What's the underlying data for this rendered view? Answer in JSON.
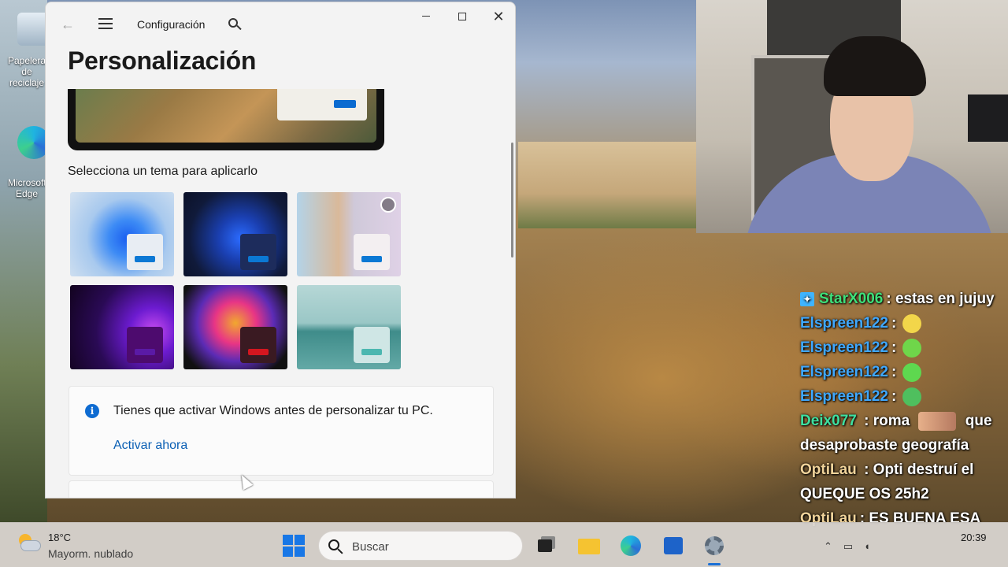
{
  "desktop": {
    "icons": [
      {
        "label": "Papelera de reciclaje"
      },
      {
        "label": "Microsoft Edge"
      }
    ]
  },
  "settings_window": {
    "app_title": "Configuración",
    "page_title": "Personalización",
    "theme_section_label": "Selecciona un tema para aplicarlo",
    "themes": [
      {
        "accent": "#0b78d4",
        "card": "#e8edf3"
      },
      {
        "accent": "#0b78d4",
        "card": "#1d2c5c"
      },
      {
        "accent": "#0b78d4",
        "card": "#f3eff1"
      },
      {
        "accent": "#5a1aa6",
        "card": "#4d0b6e"
      },
      {
        "accent": "#d4161f",
        "card": "#3a1a22"
      },
      {
        "accent": "#4cb7b0",
        "card": "#cfe6e5"
      }
    ],
    "activation": {
      "message": "Tienes que activar Windows antes de personalizar tu PC.",
      "link": "Activar ahora"
    }
  },
  "chat": {
    "messages": [
      {
        "user": "StarX006",
        "user_color": "#3ee07a",
        "text": ": estas en jujuy",
        "badge": true
      },
      {
        "user": "Elspreen122",
        "user_color": "#3fa8ff",
        "text": ":",
        "emote": "#f2d64a"
      },
      {
        "user": "Elspreen122",
        "user_color": "#3fa8ff",
        "text": ":",
        "emote": "#6fd64a"
      },
      {
        "user": "Elspreen122",
        "user_color": "#3fa8ff",
        "text": ":",
        "emote": "#5ed84f"
      },
      {
        "user": "Elspreen122",
        "user_color": "#3fa8ff",
        "text": ":",
        "emote": "#4fbf5e"
      },
      {
        "user": "Deix077",
        "user_color": "#3ee0a0",
        "text": ": roma",
        "text2": "que desaprobaste geografía"
      },
      {
        "user": "OptiLau",
        "user_color": "#f0d39a",
        "text": ": Opti destruí el QUEQUE OS 25h2"
      },
      {
        "user": "OptiLau",
        "user_color": "#f0d39a",
        "text": ": ES BUENA ESA"
      }
    ]
  },
  "taskbar": {
    "weather_temp": "18°C",
    "weather_desc": "Mayorm. nublado",
    "search_placeholder": "Buscar",
    "time": "20:39",
    "accent": "#1a6fd6"
  }
}
